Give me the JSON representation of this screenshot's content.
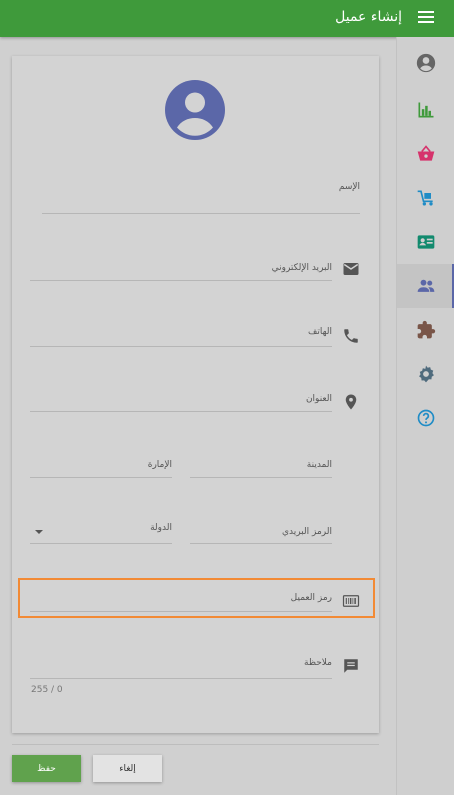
{
  "header": {
    "title": "إنشاء عميل"
  },
  "form": {
    "name_label": "الإسم",
    "email_label": "البريد الإلكتروني",
    "phone_label": "الهاتف",
    "address_label": "العنوان",
    "city_label": "المدينة",
    "emirate_label": "الإمارة",
    "postal_label": "الرمز البريدي",
    "country_label": "الدولة",
    "code_label": "رمز العميل",
    "note_label": "ملاحظة",
    "note_counter": "255 / 0"
  },
  "actions": {
    "save_label": "حفظ",
    "cancel_label": "إلغاء"
  },
  "colors": {
    "header": "#3f9a3b",
    "avatar": "#5b67a8",
    "highlight": "#f28a35",
    "save": "#60a24d"
  },
  "rail_icons": [
    "account-circle-icon",
    "bar-chart-icon",
    "basket-icon",
    "delivery-cart-icon",
    "contact-card-icon",
    "people-icon",
    "puzzle-icon",
    "settings-icon",
    "help-icon"
  ]
}
